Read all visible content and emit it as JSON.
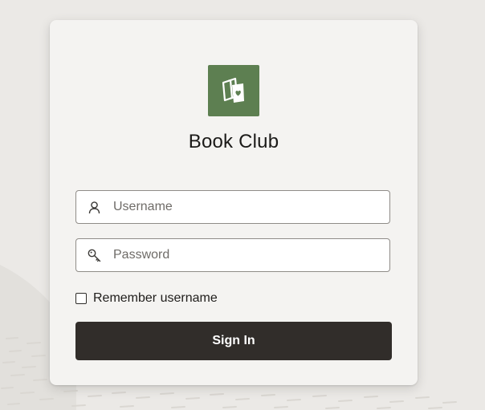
{
  "app": {
    "title": "Book Club",
    "logo_icon": "books-heart-icon",
    "accent_color": "#5d7f51"
  },
  "login_form": {
    "username": {
      "placeholder": "Username",
      "value": "",
      "icon": "user-icon"
    },
    "password": {
      "placeholder": "Password",
      "value": "",
      "icon": "key-icon"
    },
    "remember": {
      "label": "Remember username",
      "checked": false
    },
    "submit_label": "Sign In",
    "submit_color": "#312d2a"
  }
}
